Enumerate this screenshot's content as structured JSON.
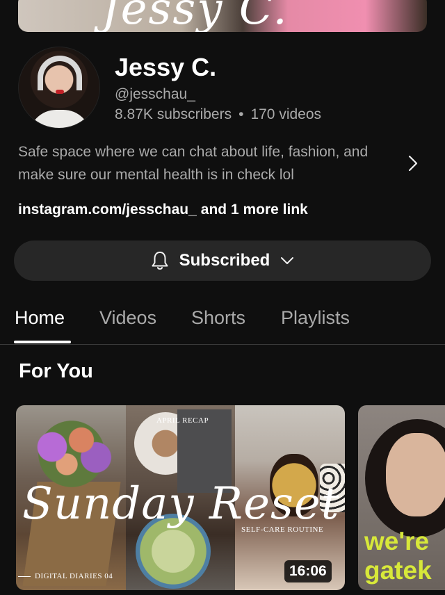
{
  "banner": {
    "script_text": "Jessy C."
  },
  "channel": {
    "name": "Jessy C.",
    "handle": "@jesschau_",
    "subscribers": "8.87K subscribers",
    "separator": "•",
    "videos": "170 videos",
    "description": "Safe space where we can chat about life, fashion, and make sure our mental health is in check lol",
    "link_text": "instagram.com/jesschau_",
    "more_links": "and 1 more link"
  },
  "subscribe_button": {
    "label": "Subscribed"
  },
  "tabs": [
    {
      "label": "Home",
      "active": true
    },
    {
      "label": "Videos",
      "active": false
    },
    {
      "label": "Shorts",
      "active": false
    },
    {
      "label": "Playlists",
      "active": false
    }
  ],
  "section": {
    "title": "For You"
  },
  "videos": [
    {
      "thumb_script": "Sunday Reset",
      "caption_top": "APRIL RECAP",
      "caption_mid": "SELF-CARE ROUTINE",
      "caption_bottom": "DIGITAL DIARIES 04",
      "duration": "16:06"
    },
    {
      "thumb_line1": "we're",
      "thumb_line2": "gatek"
    }
  ],
  "colors": {
    "background": "#0f0f0f",
    "button_bg": "#272727",
    "secondary_text": "#aaaaaa",
    "highlight": "#d7e83a"
  }
}
